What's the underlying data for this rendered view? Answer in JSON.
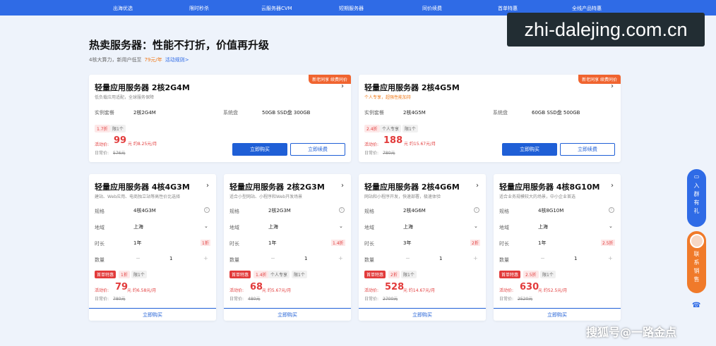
{
  "nav": [
    "出海优选",
    "限时秒杀",
    "云服务器CVM",
    "短期服务器",
    "同价续费",
    "首单特惠",
    "全线产品特惠"
  ],
  "watermark_top": "zhi-dalejing.com.cn",
  "watermark_bottom": "搜狐号@一路金点",
  "section": {
    "title": "热卖服务器：性能不打折，价值再升级",
    "sub_text": "4核大算力，新用户低至",
    "sub_price": "79元/年",
    "sub_link": "活动规则>"
  },
  "top_cards": [
    {
      "ribbon": "新老同享 续费同价",
      "title": "轻量应用服务器 2核2G4M",
      "desc": "低负载应用适配，全球服务保障",
      "spec_label": "实例套餐",
      "spec_value": "2核2G4M",
      "disk_label": "系统盘",
      "disk_value": "50GB SSD盘 300GB",
      "tags": [
        "1.7折",
        "限1个"
      ],
      "act_label": "活动价:",
      "price": "99",
      "unit": "元 约8.25元/月",
      "orig_label": "日常价:",
      "orig": "576元",
      "buy": "立即购买",
      "renew": "立即续费"
    },
    {
      "ribbon": "新老同享 续费同价",
      "title": "轻量应用服务器 2核4G5M",
      "desc": "个人专享，超强性能加持",
      "spec_label": "实例套餐",
      "spec_value": "2核4G5M",
      "disk_label": "系统盘",
      "disk_value": "60GB SSD盘 500GB",
      "tags": [
        "2.4折",
        "个人专享",
        "限1个"
      ],
      "act_label": "活动价:",
      "price": "188",
      "unit": "元 约15.67元/月",
      "orig_label": "日常价:",
      "orig": "780元",
      "buy": "立即购买",
      "renew": "立即续费"
    }
  ],
  "bottom_cards": [
    {
      "title": "轻量应用服务器 4核4G3M",
      "desc": "建站、Web应用、电商独立站等高性价比选择",
      "spec_label": "规格",
      "spec_value": "4核4G3M",
      "region_label": "地域",
      "region_value": "上海",
      "duration_label": "时长",
      "duration_value": "1年",
      "discount": "1折",
      "qty_label": "数量",
      "qty_value": "1",
      "tags": [
        "首单特惠",
        "1折",
        "限1个"
      ],
      "act_label": "活动价:",
      "price": "79",
      "unit": "元 约6.58元/月",
      "orig_label": "日常价:",
      "orig": "780元",
      "buy": "立即购买"
    },
    {
      "title": "轻量应用服务器 2核2G3M",
      "desc": "适合小型网站、小程序和Web开发场景",
      "spec_label": "规格",
      "spec_value": "2核2G3M",
      "region_label": "地域",
      "region_value": "上海",
      "duration_label": "时长",
      "duration_value": "1年",
      "discount": "1.4折",
      "qty_label": "数量",
      "qty_value": "1",
      "tags": [
        "首单特惠",
        "1.4折",
        "个人专享",
        "限1个"
      ],
      "act_label": "活动价:",
      "price": "68",
      "unit": "元 约5.67元/月",
      "orig_label": "日常价:",
      "orig": "480元",
      "buy": "立即购买"
    },
    {
      "title": "轻量应用服务器 2核4G6M",
      "desc": "网站和小程序开发，快速部署，极速体验",
      "spec_label": "规格",
      "spec_value": "2核4G6M",
      "region_label": "地域",
      "region_value": "上海",
      "duration_label": "时长",
      "duration_value": "3年",
      "discount": "2折",
      "qty_label": "数量",
      "qty_value": "1",
      "tags": [
        "首单特惠",
        "2折",
        "限1个"
      ],
      "act_label": "活动价:",
      "price": "528",
      "unit": "元 约14.67元/月",
      "orig_label": "日常价:",
      "orig": "2700元",
      "buy": "立即购买"
    },
    {
      "title": "轻量应用服务器 4核8G10M",
      "desc": "适合业务规模较大的场景，中小企业首选",
      "spec_label": "规格",
      "spec_value": "4核8G10M",
      "region_label": "地域",
      "region_value": "上海",
      "duration_label": "时长",
      "duration_value": "1年",
      "discount": "2.5折",
      "qty_label": "数量",
      "qty_value": "1",
      "tags": [
        "首单特惠",
        "2.5折",
        "限1个"
      ],
      "act_label": "活动价:",
      "price": "630",
      "unit": "元 约52.5元/月",
      "orig_label": "日常价:",
      "orig": "2520元",
      "buy": "立即购买"
    }
  ],
  "side": {
    "blue_text": "入群有礼",
    "orange_text": "联系销售"
  }
}
